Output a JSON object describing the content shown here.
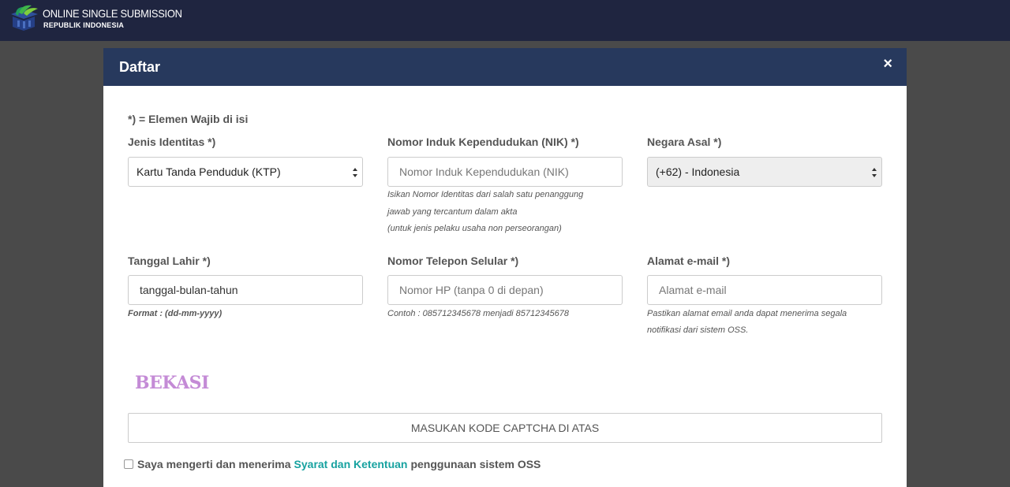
{
  "header": {
    "brand_title": "ONLINE SINGLE SUBMISSION",
    "brand_subtitle": "REPUBLIK INDONESIA",
    "bg_color": "#1f2540"
  },
  "modal": {
    "title": "Daftar",
    "close_label": "×",
    "header_color": "#27395d",
    "required_note": "*) = Elemen Wajib di isi"
  },
  "fields": {
    "identity_type": {
      "label": "Jenis Identitas *)",
      "value": "Kartu Tanda Penduduk (KTP)"
    },
    "nik": {
      "label": "Nomor Induk Kependudukan (NIK) *)",
      "placeholder": "Nomor Induk Kependudukan (NIK)",
      "help": [
        "Isikan Nomor Identitas dari salah satu penanggung",
        "jawab yang tercantum dalam akta",
        "(untuk jenis pelaku usaha non perseorangan)"
      ]
    },
    "country": {
      "label": "Negara Asal *)",
      "value": "(+62) - Indonesia"
    },
    "birth_date": {
      "label": "Tanggal Lahir *)",
      "placeholder": "tanggal-bulan-tahun",
      "help": "Format : (dd-mm-yyyy)"
    },
    "phone": {
      "label": "Nomor Telepon Selular *)",
      "placeholder": "Nomor HP (tanpa 0 di depan)",
      "help": "Contoh : 085712345678 menjadi 85712345678"
    },
    "email": {
      "label": "Alamat e-mail *)",
      "placeholder": "Alamat e-mail",
      "help": [
        "Pastikan alamat email anda dapat menerima segala",
        "notifikasi dari sistem OSS."
      ]
    }
  },
  "captcha": {
    "image_text": "BEKASI",
    "input_placeholder": "MASUKAN KODE CAPTCHA DI ATAS"
  },
  "agreement": {
    "prefix": "Saya mengerti dan menerima",
    "link_text": "Syarat dan Ketentuan",
    "suffix": "penggunaan sistem OSS",
    "link_color": "#17a2a0"
  }
}
